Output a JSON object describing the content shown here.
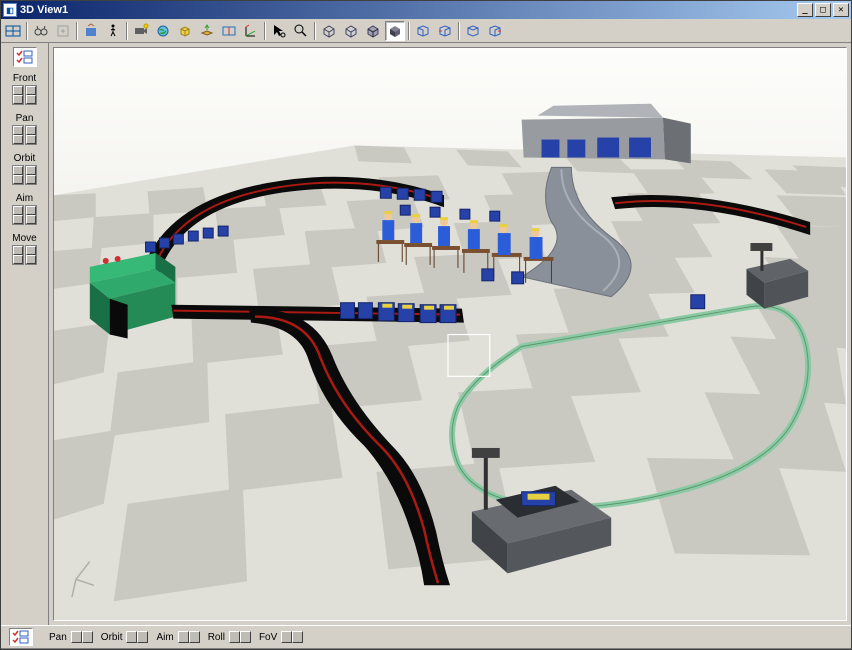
{
  "window": {
    "title": "3D View1",
    "icon_glyph": "◧"
  },
  "titlebar_buttons": {
    "minimize": "_",
    "maximize": "□",
    "close": "✕"
  },
  "top_toolbar": {
    "buttons": [
      "layout",
      "binoculars",
      "goto",
      "fit",
      "walk",
      "camera",
      "globe",
      "cube-copy",
      "layer-up",
      "section",
      "axis",
      "pointer",
      "zoom",
      "wire1",
      "wire2",
      "wire3",
      "shade",
      "box-left",
      "box-right",
      "box-back",
      "box-front"
    ]
  },
  "left_toolbar": {
    "top_button": "check-grid",
    "groups": [
      {
        "label": "Front"
      },
      {
        "label": "Pan"
      },
      {
        "label": "Orbit"
      },
      {
        "label": "Aim"
      },
      {
        "label": "Move"
      }
    ]
  },
  "bottom_toolbar": {
    "left_button": "check-grid",
    "groups": [
      {
        "label": "Pan"
      },
      {
        "label": "Orbit"
      },
      {
        "label": "Aim"
      },
      {
        "label": "Roll"
      },
      {
        "label": "FoV"
      }
    ]
  },
  "scene": {
    "description": "Factory simulation 3D scene with checkered floor, conveyor belts, green machine, blue workers at workstations, AGV loop, warehouse building.",
    "colors": {
      "floor_light": "#e8e8e3",
      "floor_dark": "#c9c9c2",
      "conveyor_top": "#0a0a0a",
      "conveyor_accent": "#aa1a12",
      "machine_green": "#2faa6c",
      "machine_green_dark": "#1a7046",
      "worker_blue": "#2b5dd8",
      "box_blue": "#2642a8",
      "building_gray": "#989ca0",
      "building_dark": "#6c7074",
      "loop_green": "#8ac9a3",
      "conveyor_gray": "#8a9099"
    }
  }
}
